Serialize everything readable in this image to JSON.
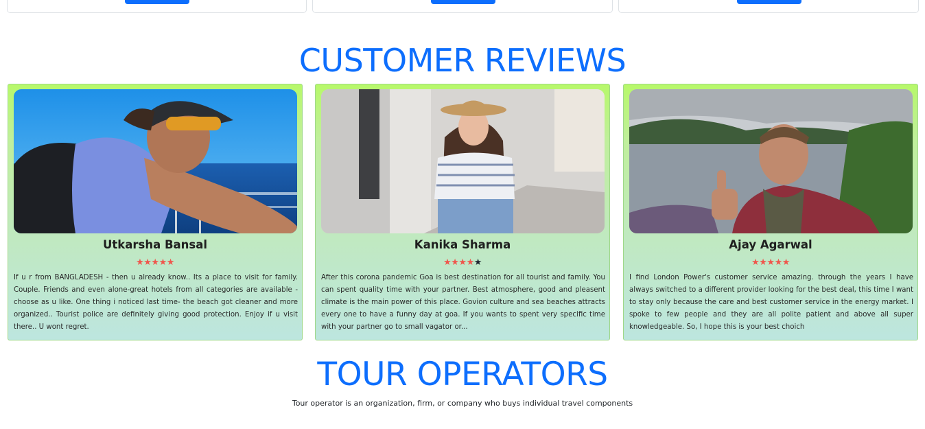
{
  "sections": {
    "reviews_title": "CUSTOMER REVIEWS",
    "operators_title": "TOUR OPERATORS",
    "operators_description": "Tour operator is an organization, firm, or company who buys individual travel components"
  },
  "reviews": [
    {
      "name": "Utkarsha Bansal",
      "rating": 5,
      "max_rating": 5,
      "photo": "man-with-cap-and-sunglasses-on-boat-at-sea",
      "text": "If u r from BANGLADESH - then u already know.. Its a place to visit for family. Couple. Friends and even alone-great hotels from all categories are available - choose as u like. One thing i noticed last time- the beach got cleaner and more organized.. Tourist police are definitely giving good protection. Enjoy if u visit there.. U wont regret."
    },
    {
      "name": "Kanika Sharma",
      "rating": 4,
      "max_rating": 5,
      "photo": "woman-in-straw-hat-on-street",
      "text": "After this corona pandemic Goa is best destination for all tourist and family. You can spent quality time with your partner. Best atmosphere, good and pleasent climate is the main power of this place. Govion culture and sea beaches attracts every one to have a funny day at goa. If you wants to spent very specific time with your partner go to small vagator or..."
    },
    {
      "name": "Ajay Agarwal",
      "rating": 5,
      "max_rating": 5,
      "photo": "man-thumbs-up-selfie-by-lake",
      "text": "I find London Power's customer service amazing. through the years I have always switched to a different provider looking for the best deal, this time I want to stay only because the care and best customer service in the energy market. I spoke to few people and they are all polite patient and above all super knowledgeable. So, I hope this is your best choich"
    }
  ],
  "colors": {
    "accent": "#0d6efd",
    "star_filled": "#f0554c",
    "star_empty": "#1d2530",
    "card_gradient_top": "#b7f86a",
    "card_gradient_bottom": "#bde6df"
  }
}
